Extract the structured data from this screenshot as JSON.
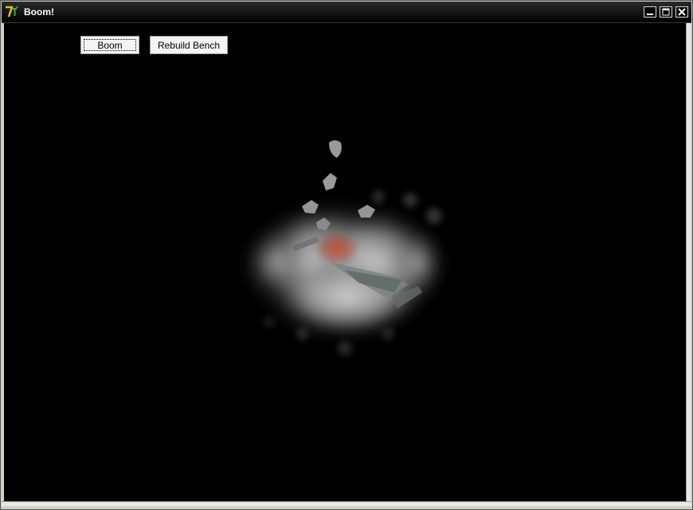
{
  "window": {
    "title": "Boom!",
    "icon": "app-logo-icon",
    "controls": [
      "minimize-icon",
      "maximize-icon",
      "close-icon"
    ]
  },
  "toolbar": {
    "boom_label": "Boom",
    "rebuild_label": "Rebuild Bench"
  },
  "viewport": {
    "background": "#000000",
    "scene": "explosion smoke cloud with debris"
  }
}
